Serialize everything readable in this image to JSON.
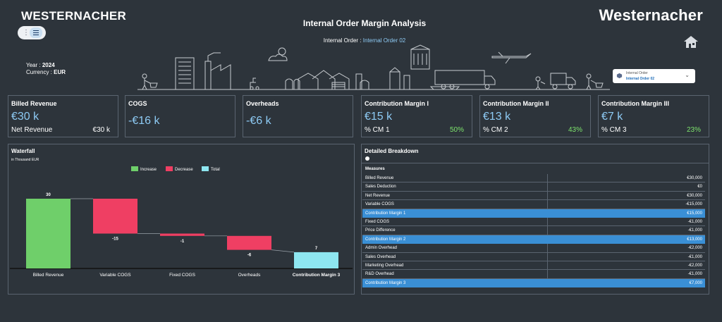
{
  "header": {
    "brand_left": "WESTERNACHER",
    "brand_right": "Westernacher",
    "title": "Internal Order Margin Analysis",
    "order_label": "Internal Order :",
    "order_value": "Internal Order 02",
    "year_label": "Year :",
    "year_value": "2024",
    "currency_label": "Currency :",
    "currency_value": "EUR",
    "menu_icon": "hamburger-icon",
    "home_icon": "home-icon"
  },
  "filter": {
    "label": "Internal Order",
    "value": "Internal Order 02",
    "icon": "cube-icon"
  },
  "kpis": [
    {
      "title": "Billed Revenue",
      "value": "€30 k",
      "sub_label": "Net Revenue",
      "sub_value": "€30 k"
    },
    {
      "title": "COGS",
      "value": "-€16 k"
    },
    {
      "title": "Overheads",
      "value": "-€6 k"
    },
    {
      "title": "Contribution Margin I",
      "value": "€15 k",
      "sub_label": "% CM 1",
      "sub_value": "50%"
    },
    {
      "title": "Contribution Margin II",
      "value": "€13 k",
      "sub_label": "% CM 2",
      "sub_value": "43%"
    },
    {
      "title": "Contribution Margin III",
      "value": "€7 k",
      "sub_label": "% CM 3",
      "sub_value": "23%"
    }
  ],
  "colors": {
    "increase": "#6fcf6a",
    "decrease": "#ef3f63",
    "total": "#8ee6f0",
    "highlight": "#3a8fd5",
    "accent_value": "#8ecbf5",
    "positive_pct": "#7de36c"
  },
  "waterfall": {
    "title": "Waterfall",
    "subtitle": "in Thousand EUR",
    "legend": [
      "Increase",
      "Decrease",
      "Total"
    ]
  },
  "chart_data": {
    "type": "bar",
    "categories": [
      "Billed Revenue",
      "Variable COGS",
      "Fixed COGS",
      "Overheads",
      "Contribution Margin 3"
    ],
    "values": [
      30,
      -15,
      -1,
      -6,
      7
    ],
    "kinds": [
      "increase",
      "decrease",
      "decrease",
      "decrease",
      "total"
    ],
    "labels": [
      "30",
      "-15",
      "-1",
      "-6",
      "7"
    ],
    "ylim": [
      0,
      30
    ]
  },
  "breakdown": {
    "title": "Detailed Breakdown",
    "header": "Measures",
    "rows": [
      {
        "label": "Billed Revenue",
        "value": "€30,000",
        "hl": false
      },
      {
        "label": "Sales Deduction",
        "value": "€0",
        "hl": false
      },
      {
        "label": "Net Revenue",
        "value": "€30,000",
        "hl": false
      },
      {
        "label": "Variable COGS",
        "value": "-€15,000",
        "hl": false
      },
      {
        "label": "Contribution Margin 1",
        "value": "€15,000",
        "hl": true
      },
      {
        "label": "Fixed COGS",
        "value": "-€1,000",
        "hl": false
      },
      {
        "label": "Price Difference",
        "value": "-€1,000",
        "hl": false
      },
      {
        "label": "Contribution Margin 2",
        "value": "€13,000",
        "hl": true
      },
      {
        "label": "Admin Overhead",
        "value": "-€2,000",
        "hl": false
      },
      {
        "label": "Sales Overhead",
        "value": "-€1,000",
        "hl": false
      },
      {
        "label": "Marketing Overhead",
        "value": "-€2,000",
        "hl": false
      },
      {
        "label": "R&D Overhead",
        "value": "-€1,000",
        "hl": false
      },
      {
        "label": "Contribution Margin 3",
        "value": "€7,000",
        "hl": true
      }
    ]
  }
}
